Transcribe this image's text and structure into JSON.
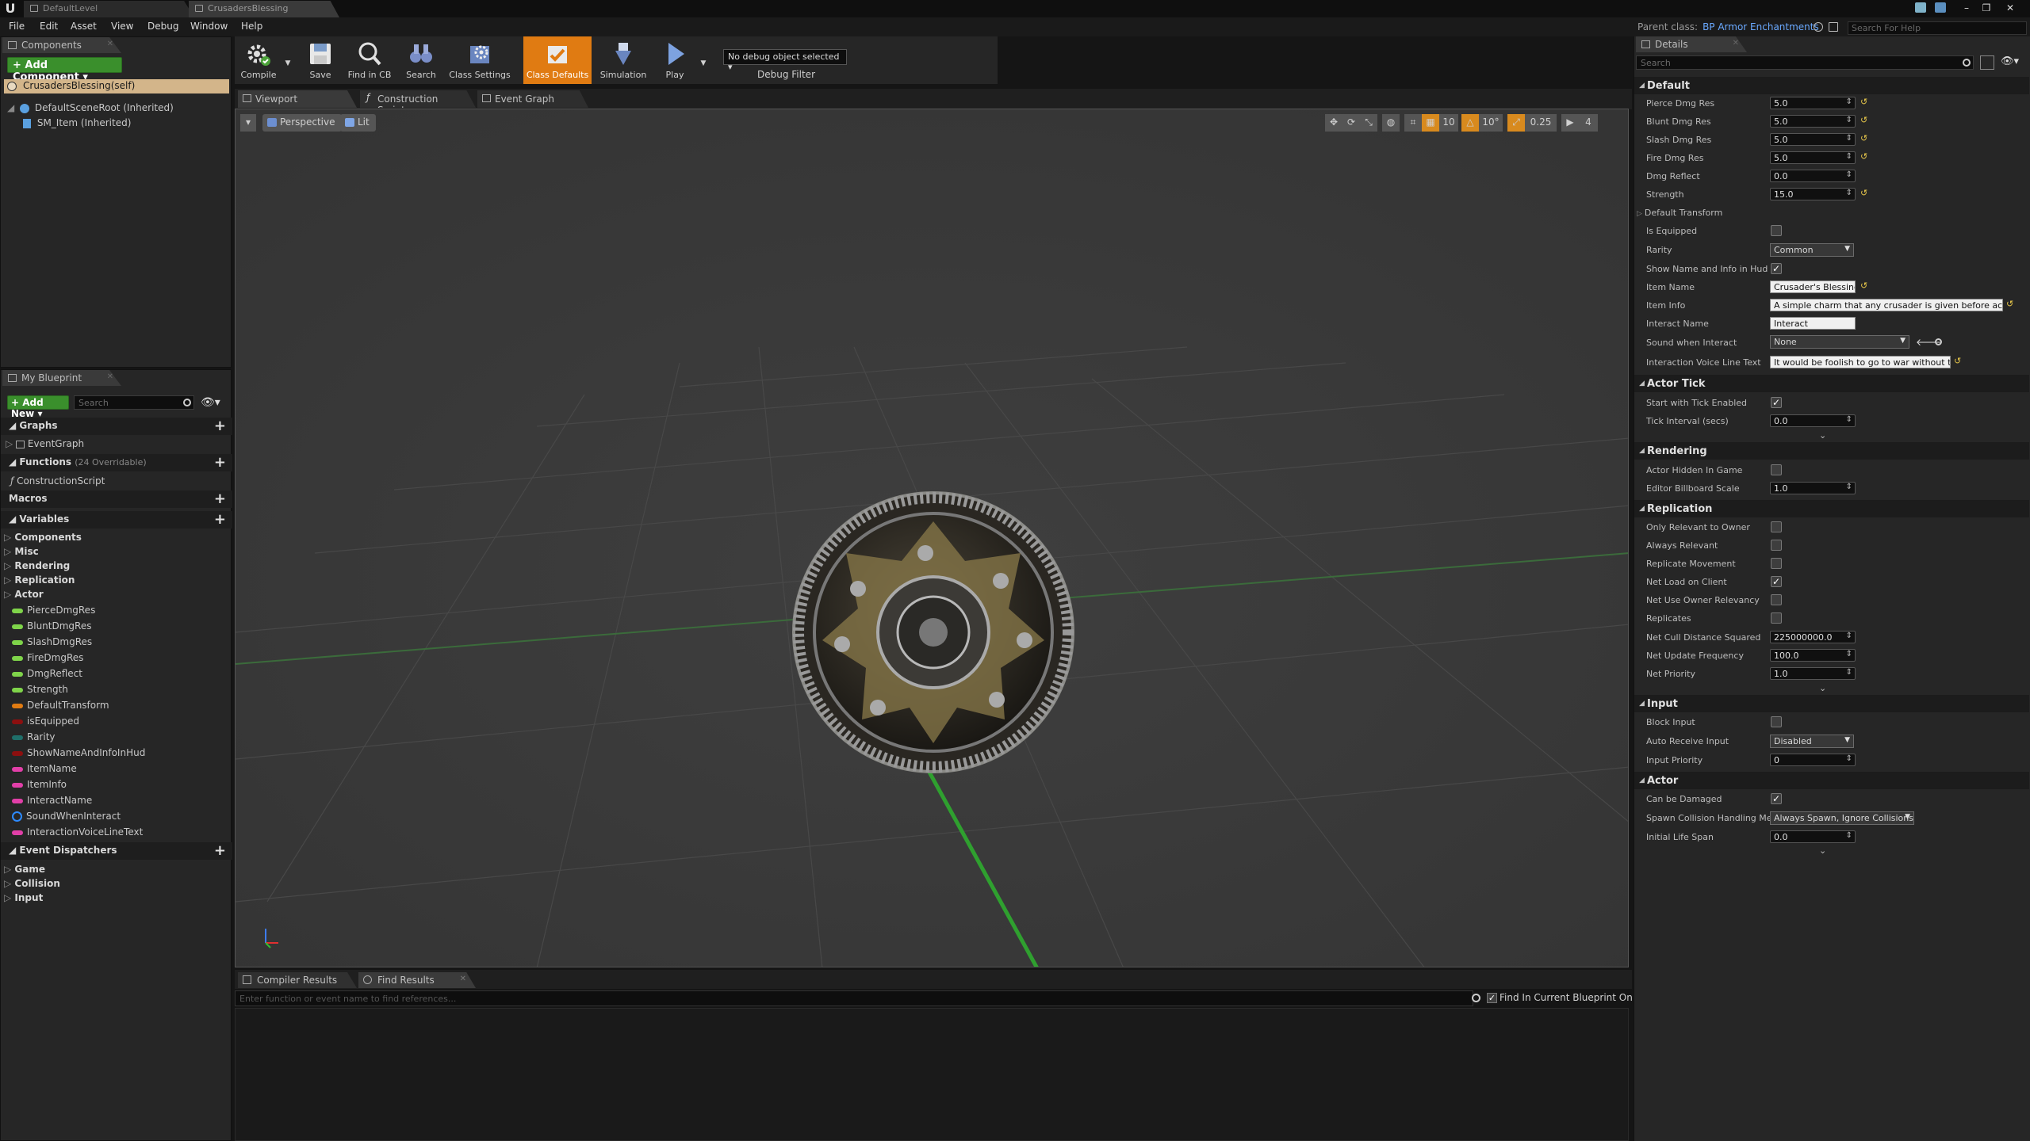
{
  "window": {
    "tabs": [
      {
        "label": "DefaultLevel"
      },
      {
        "label": "CrusadersBlessing"
      }
    ],
    "parent_class_label": "Parent class:",
    "parent_class_value": "BP Armor Enchantments",
    "help_search_placeholder": "Search For Help"
  },
  "menu": {
    "items": [
      "File",
      "Edit",
      "Asset",
      "View",
      "Debug",
      "Window",
      "Help"
    ]
  },
  "components": {
    "tab_label": "Components",
    "add_button": "+ Add Component ▾",
    "self_item": "CrusadersBlessing(self)",
    "tree": [
      "DefaultSceneRoot (Inherited)",
      "SM_Item (Inherited)"
    ]
  },
  "my_blueprint": {
    "tab_label": "My Blueprint",
    "add_new": "+ Add New ▾",
    "search_placeholder": "Search",
    "graphs_label": "Graphs",
    "graph_items": [
      "EventGraph"
    ],
    "functions_label": "Functions",
    "functions_overridable": "(24 Overridable)",
    "function_items": [
      "ConstructionScript"
    ],
    "macros_label": "Macros",
    "variables_label": "Variables",
    "variable_categories": [
      "Components",
      "Misc",
      "Rendering",
      "Replication",
      "Actor"
    ],
    "variables": [
      {
        "name": "PierceDmgRes",
        "color": "#7fd44a",
        "kind": "pill"
      },
      {
        "name": "BluntDmgRes",
        "color": "#7fd44a",
        "kind": "pill"
      },
      {
        "name": "SlashDmgRes",
        "color": "#7fd44a",
        "kind": "pill"
      },
      {
        "name": "FireDmgRes",
        "color": "#7fd44a",
        "kind": "pill"
      },
      {
        "name": "DmgReflect",
        "color": "#7fd44a",
        "kind": "pill"
      },
      {
        "name": "Strength",
        "color": "#7fd44a",
        "kind": "pill"
      },
      {
        "name": "DefaultTransform",
        "color": "#e07b12",
        "kind": "pill"
      },
      {
        "name": "isEquipped",
        "color": "#8c0f0f",
        "kind": "pill"
      },
      {
        "name": "Rarity",
        "color": "#1f6f6a",
        "kind": "pill"
      },
      {
        "name": "ShowNameAndInfoInHud",
        "color": "#8c0f0f",
        "kind": "pill"
      },
      {
        "name": "ItemName",
        "color": "#e23fa8",
        "kind": "pill"
      },
      {
        "name": "ItemInfo",
        "color": "#e23fa8",
        "kind": "pill"
      },
      {
        "name": "InteractName",
        "color": "#e23fa8",
        "kind": "pill"
      },
      {
        "name": "SoundWhenInteract",
        "color": "#2d8bff",
        "kind": "ring"
      },
      {
        "name": "InteractionVoiceLineText",
        "color": "#e23fa8",
        "kind": "pill"
      }
    ],
    "event_dispatchers_label": "Event Dispatchers",
    "dispatcher_categories": [
      "Game",
      "Collision",
      "Input"
    ]
  },
  "toolbar": {
    "compile": "Compile",
    "save": "Save",
    "find_in_cb": "Find in CB",
    "search": "Search",
    "class_settings": "Class Settings",
    "class_defaults": "Class Defaults",
    "simulation": "Simulation",
    "play": "Play",
    "debug_select": "No debug object selected ▾",
    "debug_filter": "Debug Filter"
  },
  "editor_tabs": [
    "Viewport",
    "Construction Script",
    "Event Graph"
  ],
  "viewport": {
    "perspective": "Perspective",
    "lit": "Lit",
    "grid_snap": "10",
    "rot_snap": "10°",
    "scale_snap": "0.25",
    "camera_speed": "4"
  },
  "bottom": {
    "tabs": [
      "Compiler Results",
      "Find Results"
    ],
    "find_placeholder": "Enter function or event name to find references...",
    "find_only_current": "Find In Current Blueprint Only"
  },
  "details": {
    "tab_label": "Details",
    "search_placeholder": "Search",
    "default": {
      "title": "Default",
      "pierce_label": "Pierce Dmg Res",
      "pierce": "5.0",
      "blunt_label": "Blunt Dmg Res",
      "blunt": "5.0",
      "slash_label": "Slash Dmg Res",
      "slash": "5.0",
      "fire_label": "Fire Dmg Res",
      "fire": "5.0",
      "reflect_label": "Dmg Reflect",
      "reflect": "0.0",
      "strength_label": "Strength",
      "strength": "15.0",
      "transform_label": "Default Transform",
      "equipped_label": "Is Equipped",
      "rarity_label": "Rarity",
      "rarity": "Common",
      "show_name_label": "Show Name and Info in Hud",
      "item_name_label": "Item Name",
      "item_name": "Crusader's Blessing",
      "item_info_label": "Item Info",
      "item_info": "A simple charm that any crusader is given before actual",
      "interact_name_label": "Interact Name",
      "interact_name": "Interact",
      "sound_label": "Sound when Interact",
      "sound": "None",
      "voice_label": "Interaction Voice Line Text",
      "voice": "It would be foolish to go to war without this."
    },
    "actor_tick": {
      "title": "Actor Tick",
      "start_tick_label": "Start with Tick Enabled",
      "tick_interval_label": "Tick Interval (secs)",
      "tick_interval": "0.0"
    },
    "rendering": {
      "title": "Rendering",
      "hidden_label": "Actor Hidden In Game",
      "billboard_label": "Editor Billboard Scale",
      "billboard": "1.0"
    },
    "replication": {
      "title": "Replication",
      "only_owner_label": "Only Relevant to Owner",
      "always_label": "Always Relevant",
      "rep_movement_label": "Replicate Movement",
      "net_load_label": "Net Load on Client",
      "owner_relevancy_label": "Net Use Owner Relevancy",
      "replicates_label": "Replicates",
      "cull_label": "Net Cull Distance Squared",
      "cull": "225000000.0",
      "update_freq_label": "Net Update Frequency",
      "update_freq": "100.0",
      "priority_label": "Net Priority",
      "priority": "1.0"
    },
    "input": {
      "title": "Input",
      "block_label": "Block Input",
      "auto_receive_label": "Auto Receive Input",
      "auto_receive": "Disabled",
      "input_priority_label": "Input Priority",
      "input_priority": "0"
    },
    "actor": {
      "title": "Actor",
      "damaged_label": "Can be Damaged",
      "spawn_label": "Spawn Collision Handling Met",
      "spawn": "Always Spawn, Ignore Collisions",
      "lifespan_label": "Initial Life Span",
      "lifespan": "0.0"
    }
  }
}
